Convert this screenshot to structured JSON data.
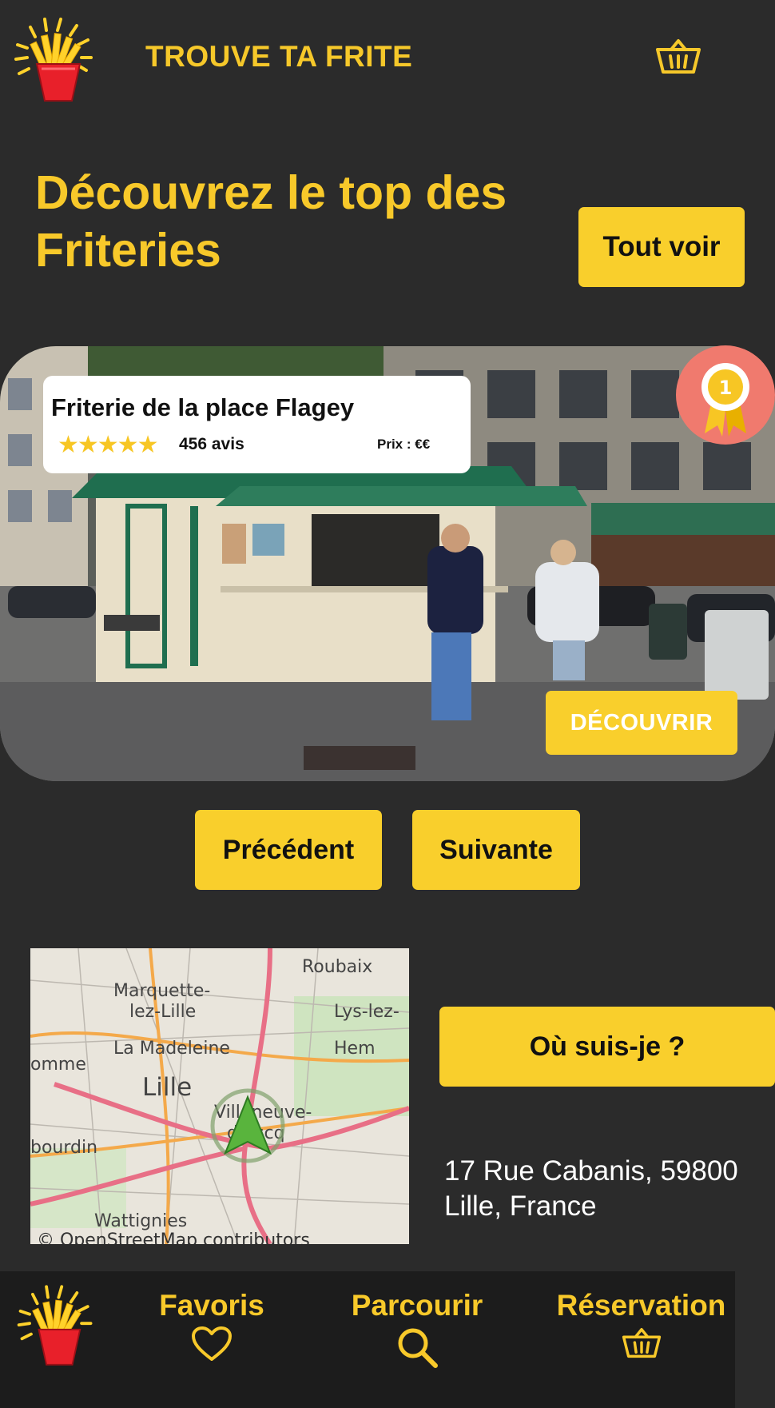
{
  "header": {
    "title": "TROUVE TA FRITE",
    "logo_icon": "fries-icon",
    "cart_icon": "basket-icon"
  },
  "hero": {
    "title": "Découvrez le top des Friteries",
    "see_all_label": "Tout voir"
  },
  "featured": {
    "name": "Friterie de la place Flagey",
    "stars": "★★★★★",
    "rating": 5,
    "reviews": "456 avis",
    "price": "Prix : €€",
    "rank_badge": "1",
    "discover_label": "DÉCOUVRIR"
  },
  "pagination": {
    "prev_label": "Précédent",
    "next_label": "Suivante"
  },
  "map": {
    "labels": {
      "roubaix": "Roubaix",
      "marquette": "Marquette-",
      "marquette2": "lez-Lille",
      "lys": "Lys-lez-",
      "madeleine": "La Madeleine",
      "hem": "Hem",
      "omme": "omme",
      "lille": "Lille",
      "villeneuve": "Villeneuve-",
      "ascq": "d'Ascq",
      "bourdin": "bourdin",
      "wattignies": "Wattignies"
    },
    "attribution": "© OpenStreetMap contributors"
  },
  "location": {
    "button_label": "Où suis-je ?",
    "address": "17 Rue Cabanis, 59800 Lille, France"
  },
  "bottom_nav": {
    "favorites": "Favoris",
    "browse": "Parcourir",
    "reservation": "Réservation"
  },
  "colors": {
    "background": "#2b2b2b",
    "accent": "#f9cf2c",
    "nav_background": "#1c1c1c"
  }
}
